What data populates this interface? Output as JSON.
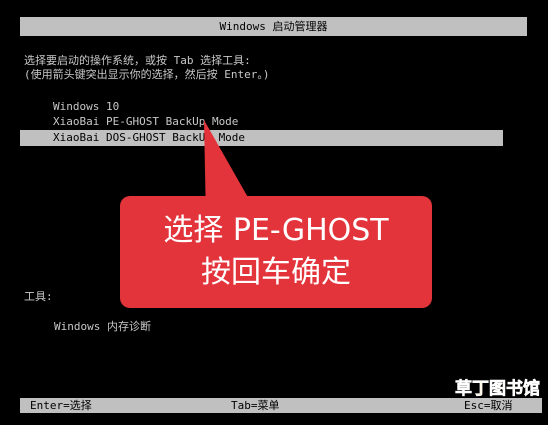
{
  "window": {
    "title": "Windows 启动管理器"
  },
  "prompt": {
    "line1": "选择要启动的操作系统，或按 Tab 选择工具:",
    "line2": "(使用箭头键突出显示你的选择，然后按 Enter。)"
  },
  "os_list": [
    {
      "label": "Windows 10",
      "selected": false
    },
    {
      "label": "XiaoBai PE-GHOST BackUp Mode",
      "selected": false
    },
    {
      "label": "XiaoBai DOS-GHOST BackUp Mode",
      "selected": true
    }
  ],
  "tools": {
    "label": "工具:",
    "items": [
      {
        "label": "Windows 内存诊断"
      }
    ]
  },
  "callout": {
    "line1": "选择 PE-GHOST",
    "line2": "按回车确定",
    "color": "#e3343b"
  },
  "footer": {
    "enter": "Enter=选择",
    "tab": "Tab=菜单",
    "esc": "Esc=取消"
  },
  "watermark": {
    "text": "草丁图书馆"
  }
}
